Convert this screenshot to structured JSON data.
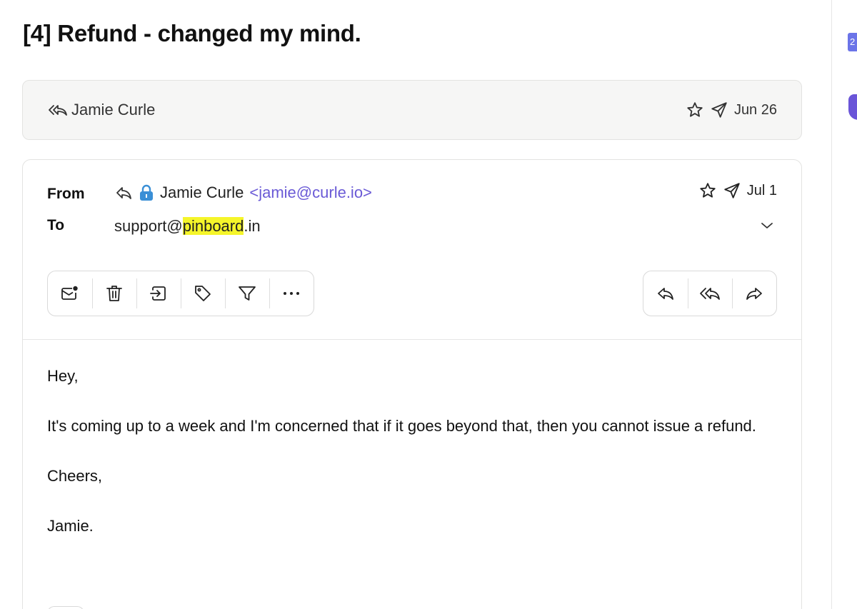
{
  "subject": "[4] Refund - changed my mind.",
  "collapsed_message": {
    "sender": "Jamie Curle",
    "date": "Jun 26"
  },
  "message": {
    "from_label": "From",
    "to_label": "To",
    "from_name": "Jamie Curle",
    "from_email": "<jamie@curle.io>",
    "to_prefix": "support@",
    "to_highlight": "pinboard",
    "to_suffix": ".in",
    "date": "Jul 1",
    "body": [
      "Hey,",
      "It's coming up to a week and I'm concerned that if it goes beyond that, then you cannot issue a refund.",
      "Cheers,",
      "Jamie."
    ]
  },
  "toolbar_left": [
    "mark-unread-icon",
    "trash-icon",
    "move-to-folder-icon",
    "tag-icon",
    "filter-icon",
    "more-icon"
  ],
  "toolbar_right": [
    "reply-icon",
    "reply-all-icon",
    "forward-icon"
  ],
  "right_rail": {
    "badge": "2"
  },
  "colors": {
    "accent": "#6a5ad6",
    "highlight": "#f5f52a",
    "collapsed_bg": "#f6f6f5"
  }
}
